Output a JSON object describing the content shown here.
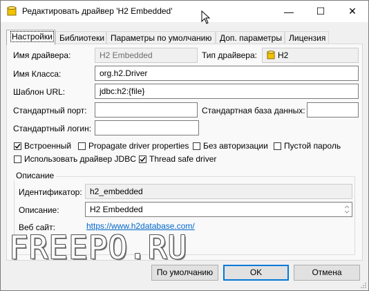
{
  "window": {
    "title": "Редактировать драйвер 'H2 Embedded'",
    "minimize_glyph": "—",
    "maximize_glyph": "☐",
    "close_glyph": "✕"
  },
  "tabs": [
    {
      "label": "Настройки",
      "active": true
    },
    {
      "label": "Библиотеки",
      "active": false
    },
    {
      "label": "Параметры по умолчанию",
      "active": false
    },
    {
      "label": "Доп. параметры",
      "active": false
    },
    {
      "label": "Лицензия",
      "active": false
    }
  ],
  "settings": {
    "driver_name_label": "Имя драйвера:",
    "driver_name_value": "H2 Embedded",
    "driver_type_label": "Тип драйвера:",
    "driver_type_value": "H2",
    "class_name_label": "Имя Класса:",
    "class_name_value": "org.h2.Driver",
    "url_template_label": "Шаблон URL:",
    "url_template_value": "jdbc:h2:{file}",
    "default_port_label": "Стандартный порт:",
    "default_port_value": "",
    "default_db_label": "Стандартная база данных:",
    "default_db_value": "",
    "default_login_label": "Стандартный логин:",
    "default_login_value": ""
  },
  "checkboxes": {
    "embedded": {
      "label": "Встроенный",
      "checked": true
    },
    "propagate": {
      "label": "Propagate driver properties",
      "checked": false
    },
    "no_auth": {
      "label": "Без авторизации",
      "checked": false
    },
    "empty_password": {
      "label": "Пустой пароль",
      "checked": false
    },
    "use_jdbc": {
      "label": "Использовать драйвер JDBC",
      "checked": false
    },
    "thread_safe": {
      "label": "Thread safe driver",
      "checked": true
    }
  },
  "description": {
    "group_title": "Описание",
    "id_label": "Идентификатор:",
    "id_value": "h2_embedded",
    "desc_label": "Описание:",
    "desc_value": "H2 Embedded",
    "website_label": "Веб сайт:",
    "website_value": "https://www.h2database.com/"
  },
  "watermark": "FREEPO.RU",
  "buttons": {
    "defaults": "По умолчанию",
    "ok": "OK",
    "cancel": "Отмена"
  },
  "colors": {
    "link": "#0066cc",
    "default_button_border": "#0078d7",
    "db_icon": "#f2c200"
  }
}
